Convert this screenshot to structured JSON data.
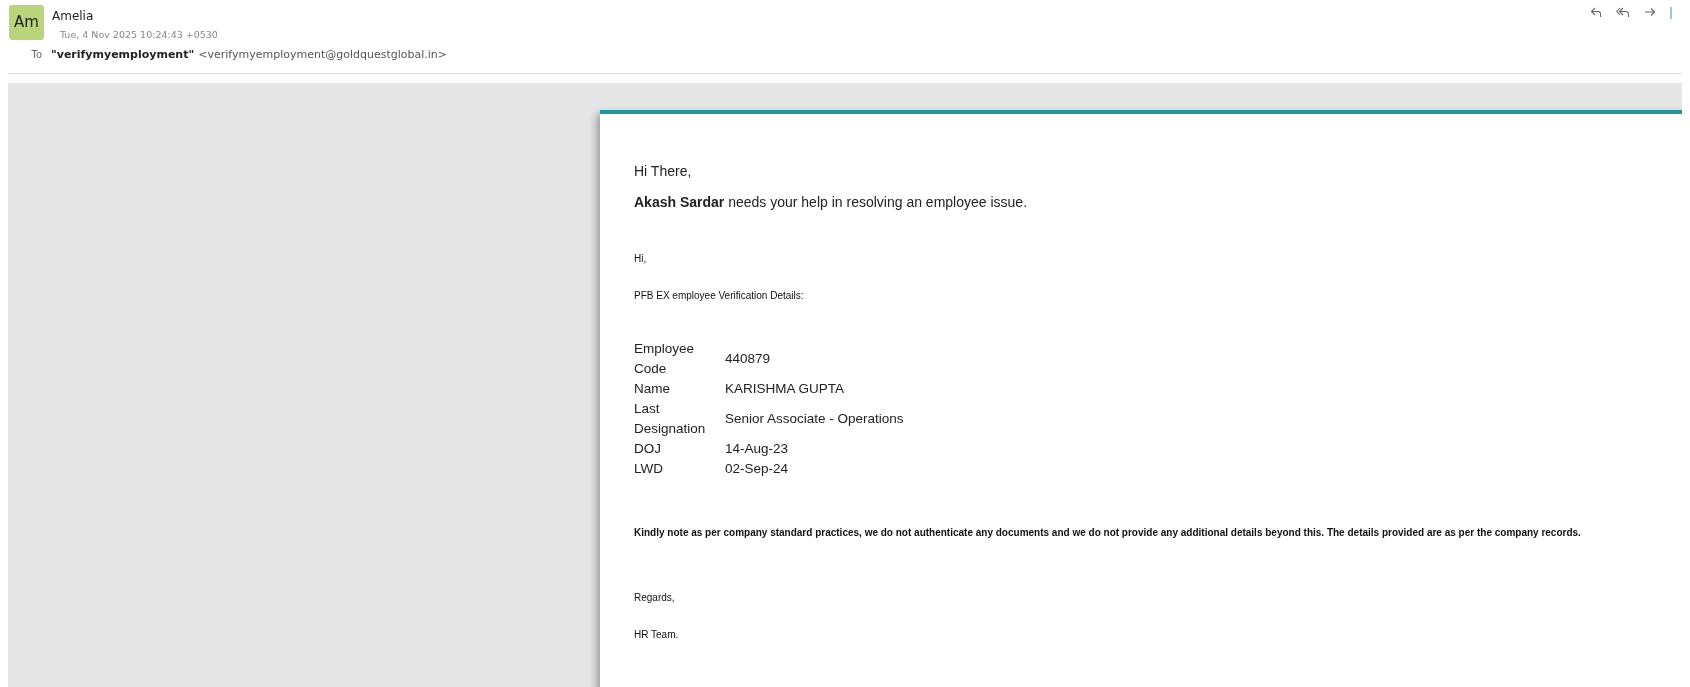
{
  "header": {
    "avatar": "Am",
    "sender": "Amelia",
    "date": "Tue, 4 Nov 2025 10:24:43 +0530",
    "to_label": "To",
    "to_name": "\"verifymyemployment\"",
    "to_address": "<verifymyemployment@goldquestglobal.in>"
  },
  "body": {
    "greeting": "Hi There,",
    "intro": "**Akash Sardar** needs your help in resolving an employee issue.",
    "salutation": "Hi,",
    "lead_in": "PFB EX employee Verification Details:",
    "details": [
      {
        "label": "Employee Code",
        "value": "440879"
      },
      {
        "label": "Name",
        "value": "KARISHMA GUPTA"
      },
      {
        "label": "Last Designation",
        "value": "Senior Associate - Operations"
      },
      {
        "label": "DOJ",
        "value": "14-Aug-23"
      },
      {
        "label": "LWD",
        "value": "02-Sep-24"
      }
    ],
    "note": "Kindly note as per company standard practices, we do not authenticate any documents and we do not provide any additional details beyond this. The details provided are as per the company records.",
    "closing": "Regards,",
    "signature": "HR Team."
  }
}
